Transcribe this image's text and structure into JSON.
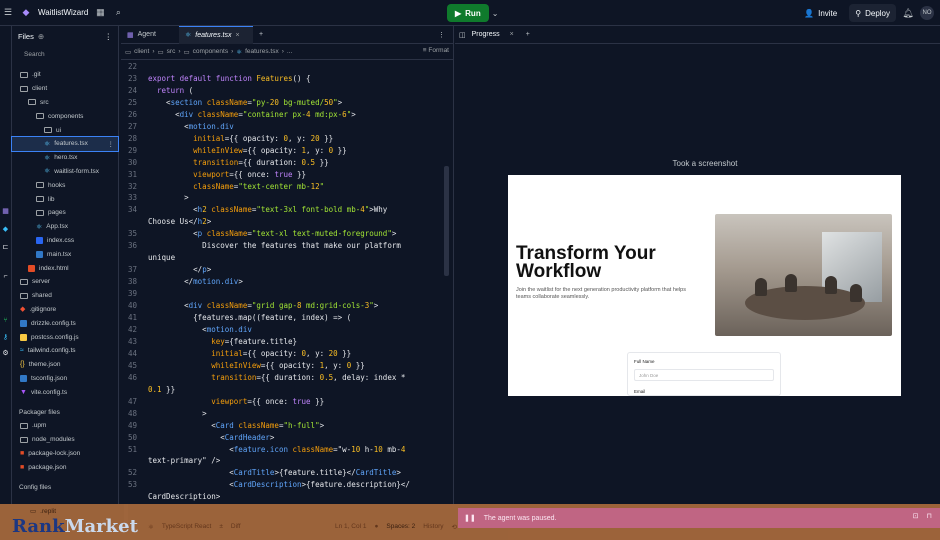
{
  "topbar": {
    "app_name": "WaitlistWizard",
    "run_label": "Run",
    "invite_label": "Invite",
    "deploy_label": "Deploy",
    "avatar_initials": "NO"
  },
  "files": {
    "title": "Files",
    "search_placeholder": "Search",
    "tree": [
      {
        "label": ".git",
        "icon": "folder",
        "depth": 0
      },
      {
        "label": "client",
        "icon": "folder",
        "depth": 0
      },
      {
        "label": "src",
        "icon": "folder",
        "depth": 1
      },
      {
        "label": "components",
        "icon": "folder",
        "depth": 2
      },
      {
        "label": "ui",
        "icon": "folder",
        "depth": 3
      },
      {
        "label": "features.tsx",
        "icon": "react",
        "depth": 3,
        "selected": true
      },
      {
        "label": "hero.tsx",
        "icon": "react",
        "depth": 3
      },
      {
        "label": "waitlist-form.tsx",
        "icon": "react",
        "depth": 3
      },
      {
        "label": "hooks",
        "icon": "folder",
        "depth": 2
      },
      {
        "label": "lib",
        "icon": "folder",
        "depth": 2
      },
      {
        "label": "pages",
        "icon": "folder",
        "depth": 2
      },
      {
        "label": "App.tsx",
        "icon": "react",
        "depth": 2
      },
      {
        "label": "index.css",
        "icon": "css",
        "depth": 2
      },
      {
        "label": "main.tsx",
        "icon": "ts",
        "depth": 2
      },
      {
        "label": "index.html",
        "icon": "html",
        "depth": 1
      },
      {
        "label": "server",
        "icon": "folder",
        "depth": 0
      },
      {
        "label": "shared",
        "icon": "folder",
        "depth": 0
      },
      {
        "label": ".gitignore",
        "icon": "git",
        "depth": 0
      },
      {
        "label": "drizzle.config.ts",
        "icon": "ts",
        "depth": 0
      },
      {
        "label": "postcss.config.js",
        "icon": "js",
        "depth": 0
      },
      {
        "label": "tailwind.config.ts",
        "icon": "tw",
        "depth": 0
      },
      {
        "label": "theme.json",
        "icon": "json",
        "depth": 0
      },
      {
        "label": "tsconfig.json",
        "icon": "ts",
        "depth": 0
      },
      {
        "label": "vite.config.ts",
        "icon": "vite",
        "depth": 0
      }
    ],
    "packager_label": "Packager files",
    "packager": [
      {
        "label": ".upm",
        "icon": "folder"
      },
      {
        "label": "node_modules",
        "icon": "folder"
      },
      {
        "label": "package-lock.json",
        "icon": "lock"
      },
      {
        "label": "package.json",
        "icon": "pkg"
      }
    ],
    "config_label": "Config files",
    "config": [
      {
        "label": ".replit",
        "icon": "file"
      }
    ]
  },
  "editor": {
    "tabs": [
      {
        "label": "Agent"
      },
      {
        "label": "features.tsx",
        "active": true
      }
    ],
    "breadcrumb": [
      "client",
      "src",
      "components",
      "features.tsx",
      "..."
    ],
    "format_label": "Format",
    "lines": [
      {
        "n": "22",
        "t": ""
      },
      {
        "n": "23",
        "t": "export default function Features() {"
      },
      {
        "n": "24",
        "t": "  return ("
      },
      {
        "n": "25",
        "t": "    <section className=\"py-20 bg-muted/50\">"
      },
      {
        "n": "26",
        "t": "      <div className=\"container px-4 md:px-6\">"
      },
      {
        "n": "27",
        "t": "        <motion.div"
      },
      {
        "n": "28",
        "t": "          initial={{ opacity: 0, y: 20 }}"
      },
      {
        "n": "29",
        "t": "          whileInView={{ opacity: 1, y: 0 }}"
      },
      {
        "n": "30",
        "t": "          transition={{ duration: 0.5 }}"
      },
      {
        "n": "31",
        "t": "          viewport={{ once: true }}"
      },
      {
        "n": "32",
        "t": "          className=\"text-center mb-12\""
      },
      {
        "n": "33",
        "t": "        >"
      },
      {
        "n": "34",
        "t": "          <h2 className=\"text-3xl font-bold mb-4\">Why"
      },
      {
        "n": "",
        "t": "Choose Us</h2>"
      },
      {
        "n": "35",
        "t": "          <p className=\"text-xl text-muted-foreground\">"
      },
      {
        "n": "36",
        "t": "            Discover the features that make our platform"
      },
      {
        "n": "",
        "t": "unique"
      },
      {
        "n": "37",
        "t": "          </p>"
      },
      {
        "n": "38",
        "t": "        </motion.div>"
      },
      {
        "n": "39",
        "t": ""
      },
      {
        "n": "40",
        "t": "        <div className=\"grid gap-8 md:grid-cols-3\">"
      },
      {
        "n": "41",
        "t": "          {features.map((feature, index) => ("
      },
      {
        "n": "42",
        "t": "            <motion.div"
      },
      {
        "n": "43",
        "t": "              key={feature.title}"
      },
      {
        "n": "44",
        "t": "              initial={{ opacity: 0, y: 20 }}"
      },
      {
        "n": "45",
        "t": "              whileInView={{ opacity: 1, y: 0 }}"
      },
      {
        "n": "46",
        "t": "              transition={{ duration: 0.5, delay: index *"
      },
      {
        "n": "",
        "t": "0.1 }}"
      },
      {
        "n": "47",
        "t": "              viewport={{ once: true }}"
      },
      {
        "n": "48",
        "t": "            >"
      },
      {
        "n": "49",
        "t": "              <Card className=\"h-full\">"
      },
      {
        "n": "50",
        "t": "                <CardHeader>"
      },
      {
        "n": "51",
        "t": "                  <feature.icon className=\"w-10 h-10 mb-4"
      },
      {
        "n": "",
        "t": "text-primary\" />"
      },
      {
        "n": "52",
        "t": "                  <CardTitle>{feature.title}</CardTitle>"
      },
      {
        "n": "53",
        "t": "                  <CardDescription>{feature.description}</"
      },
      {
        "n": "",
        "t": "CardDescription>"
      }
    ]
  },
  "status": {
    "brand_left": "Rank",
    "brand_right": "Market",
    "language": "TypeScript React",
    "diff_label": "Diff",
    "position": "Ln 1, Col 1",
    "spaces": "Spaces: 2",
    "history": "History",
    "repl_file": ".replit"
  },
  "right": {
    "tab_label": "Progress",
    "screenshot_caption": "Took a screenshot",
    "hero_title": "Transform Your Workflow",
    "hero_sub": "Join the waitlist for the next generation productivity platform that helps teams collaborate seamlessly.",
    "form_full_name_label": "Full Name",
    "form_full_name_placeholder": "John Doe",
    "form_email_label": "Email",
    "paused_text": "The agent was paused."
  }
}
